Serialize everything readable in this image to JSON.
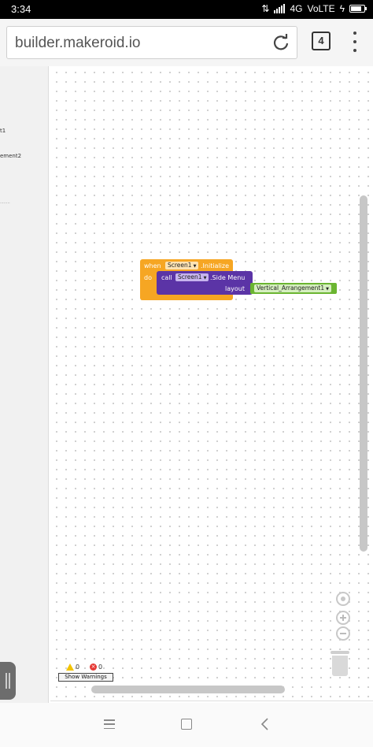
{
  "status_bar": {
    "time": "3:34",
    "network": "4G",
    "volte": "VoLTE",
    "battery_level": 0.8
  },
  "browser": {
    "url": "builder.makeroid.io",
    "tab_count": "4",
    "icons": [
      "reload-icon",
      "more-menu-icon"
    ]
  },
  "left_panel": {
    "items": [
      "t1",
      "ement2",
      "........"
    ]
  },
  "blocks": {
    "event": {
      "when_label": "when",
      "component": "Screen1",
      "event_name": ".Initialize",
      "do_label": "do",
      "color": "#f6a623"
    },
    "call": {
      "call_label": "call",
      "component": "Screen1",
      "method_name": ".Side Menu",
      "param_label": "layout",
      "color": "#5b34a6"
    },
    "argument": {
      "component": "Vertical_Arrangement1",
      "color": "#6bb531"
    }
  },
  "warnings": {
    "warning_count": "0",
    "error_count": "0",
    "show_warnings_label": "Show Warnings"
  },
  "workspace_controls": {
    "icons": [
      "zoom-reset-icon",
      "zoom-in-icon",
      "zoom-out-icon",
      "trash-icon"
    ]
  },
  "nav_bar": {
    "icons": [
      "recent-apps-icon",
      "home-icon",
      "back-icon"
    ]
  }
}
